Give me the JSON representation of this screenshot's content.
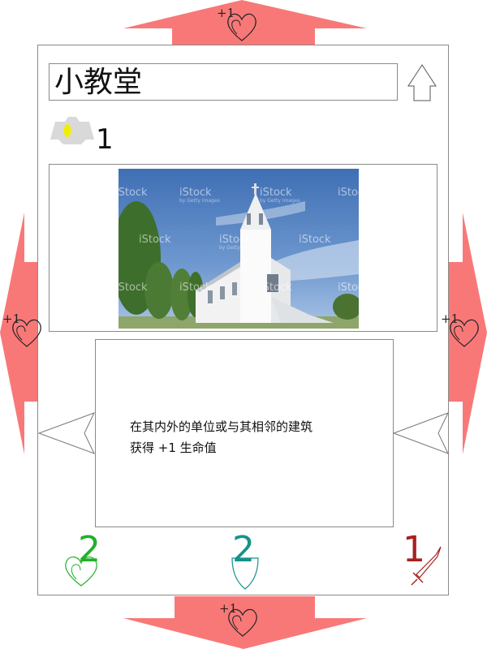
{
  "card": {
    "title": "小教堂",
    "level": "1",
    "description_line1": "在其内外的单位或与其相邻的建筑",
    "description_line2": "获得 +1 生命值",
    "image_watermark": "iStock",
    "image_watermark_sub": "by Getty Images"
  },
  "stats": {
    "health": "2",
    "defense": "2",
    "attack": "1"
  },
  "side_bonuses": {
    "top": "+1",
    "bottom": "+1",
    "left": "+1",
    "right": "+1"
  },
  "colors": {
    "arrow": "#f87878",
    "health": "#22b02a",
    "defense": "#17928a",
    "attack": "#a82020"
  },
  "icons": {
    "upgrade": "up-arrow-icon",
    "level": "gem-badge-icon",
    "health": "heart-icon",
    "defense": "shield-icon",
    "attack": "sword-icon",
    "bonus": "heart-plus-icon"
  }
}
